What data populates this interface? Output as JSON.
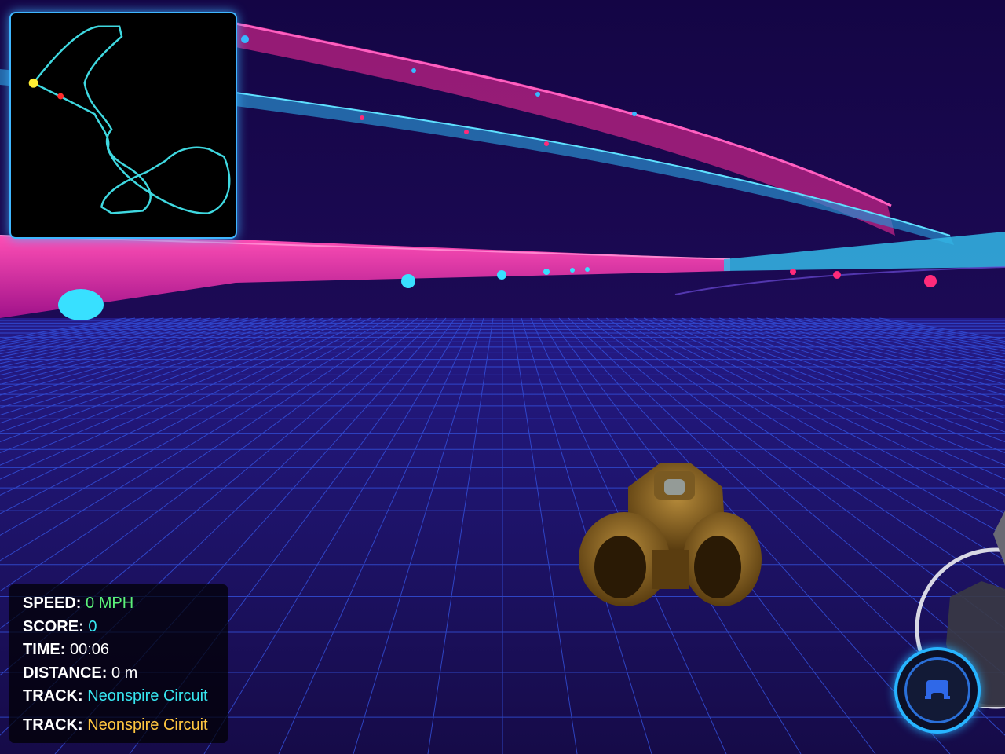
{
  "hud": {
    "speed_label": "SPEED:",
    "speed_value": "0 MPH",
    "score_label": "SCORE:",
    "score_value": "0",
    "time_label": "TIME:",
    "time_value": "00:06",
    "distance_label": "DISTANCE:",
    "distance_value": "0 m",
    "track_label": "TRACK:",
    "track_value": "Neonspire Circuit",
    "track_label_2": "TRACK:",
    "track_value_2": "Neonspire Circuit"
  },
  "minimap": {
    "track_color": "#3fd8e0",
    "player_color": "#ffee33",
    "opponent_color": "#ff2b2b"
  },
  "camera_button": {
    "icon": "car-view-icon"
  },
  "colors": {
    "sky": "#140545",
    "grid": "#2d4fd9",
    "neon_pink": "#ff2d9b",
    "neon_cyan": "#39d9ff",
    "hud_speed": "#5cf27a",
    "hud_cyan": "#37e6f0",
    "hud_gold": "#ffc640"
  }
}
